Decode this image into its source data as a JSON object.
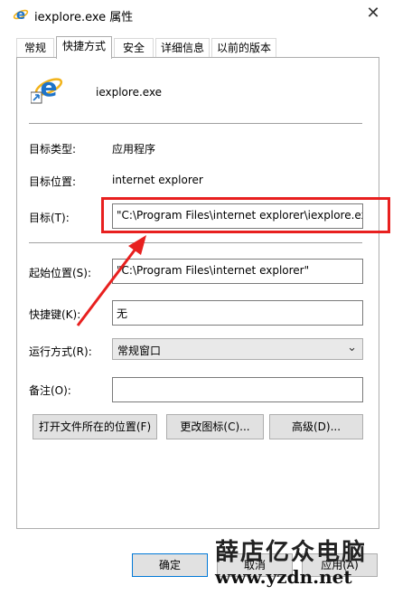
{
  "window": {
    "title": "iexplore.exe 属性",
    "close_glyph": "✕"
  },
  "tabs": [
    {
      "label": "常规"
    },
    {
      "label": "快捷方式",
      "active": true
    },
    {
      "label": "安全"
    },
    {
      "label": "详细信息"
    },
    {
      "label": "以前的版本"
    }
  ],
  "shortcut": {
    "app_name": "iexplore.exe",
    "type_label": "目标类型:",
    "type_value": "应用程序",
    "location_label": "目标位置:",
    "location_value": "internet explorer",
    "target_label": "目标(T):",
    "target_value": "\"C:\\Program Files\\internet explorer\\iexplore.exe\"",
    "start_label": "起始位置(S):",
    "start_value": "\"C:\\Program Files\\internet explorer\"",
    "hotkey_label": "快捷键(K):",
    "hotkey_value": "无",
    "run_label": "运行方式(R):",
    "run_value": "常规窗口",
    "comment_label": "备注(O):",
    "comment_value": ""
  },
  "buttons": {
    "open_location": "打开文件所在的位置(F)",
    "change_icon": "更改图标(C)...",
    "advanced": "高级(D)..."
  },
  "footer": {
    "ok": "确定",
    "cancel": "取消",
    "apply": "应用(A)"
  },
  "watermark": {
    "cn": "薛店亿众电脑",
    "url": "www.yzdn.net"
  },
  "colors": {
    "highlight": "#e8201f",
    "ie_blue": "#1e73c8",
    "ie_gold": "#f2b31b"
  }
}
